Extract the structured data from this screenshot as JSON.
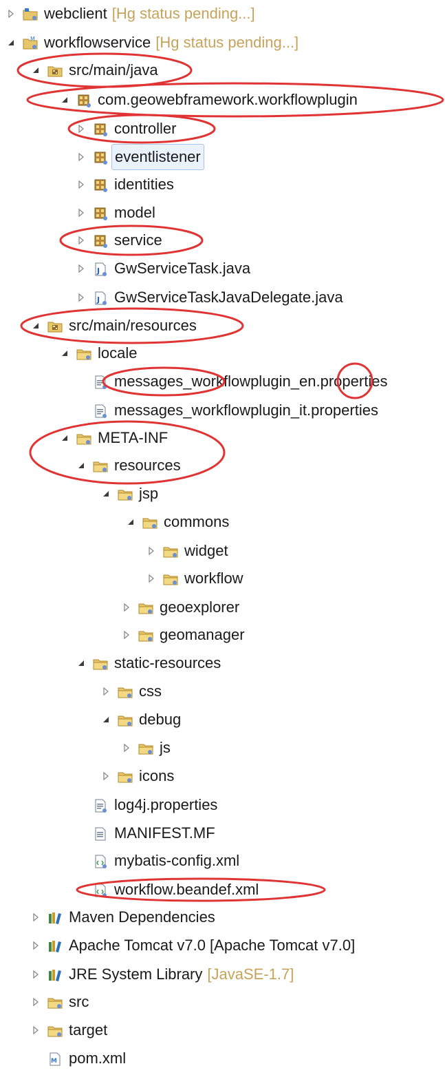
{
  "colors": {
    "annotation": "#e03434",
    "decoration": "#c6a35a",
    "selection_bg": "#eaf2fb"
  },
  "tree": [
    {
      "label": "webclient",
      "decoration": "[Hg status pending...]",
      "icon": "project-icon",
      "expanded": false
    },
    {
      "label": "workflowservice",
      "decoration": "[Hg status pending...]",
      "icon": "maven-project-icon",
      "expanded": true
    },
    {
      "label": "src/main/java",
      "icon": "source-folder-icon",
      "expanded": true
    },
    {
      "label": "com.geowebframework.workflowplugin",
      "icon": "package-icon",
      "expanded": true
    },
    {
      "label": "controller",
      "icon": "package-icon",
      "expanded": false
    },
    {
      "label": "eventlistener",
      "icon": "package-icon",
      "expanded": false,
      "selected": true
    },
    {
      "label": "identities",
      "icon": "package-icon",
      "expanded": false
    },
    {
      "label": "model",
      "icon": "package-icon",
      "expanded": false
    },
    {
      "label": "service",
      "icon": "package-icon",
      "expanded": false
    },
    {
      "label": "GwServiceTask.java",
      "icon": "java-file-icon",
      "expanded": false
    },
    {
      "label": "GwServiceTaskJavaDelegate.java",
      "icon": "java-file-icon",
      "expanded": false
    },
    {
      "label": "src/main/resources",
      "icon": "source-folder-icon",
      "expanded": true
    },
    {
      "label": "locale",
      "icon": "folder-icon",
      "expanded": true
    },
    {
      "label": "messages_workflowplugin_en.properties",
      "icon": "properties-file-icon"
    },
    {
      "label": "messages_workflowplugin_it.properties",
      "icon": "properties-file-icon"
    },
    {
      "label": "META-INF",
      "icon": "folder-icon",
      "expanded": true
    },
    {
      "label": "resources",
      "icon": "folder-icon",
      "expanded": true
    },
    {
      "label": "jsp",
      "icon": "folder-icon",
      "expanded": true
    },
    {
      "label": "commons",
      "icon": "folder-icon",
      "expanded": true
    },
    {
      "label": "widget",
      "icon": "folder-icon",
      "expanded": false
    },
    {
      "label": "workflow",
      "icon": "folder-icon",
      "expanded": false
    },
    {
      "label": "geoexplorer",
      "icon": "folder-icon",
      "expanded": false
    },
    {
      "label": "geomanager",
      "icon": "folder-icon",
      "expanded": false
    },
    {
      "label": "static-resources",
      "icon": "folder-icon",
      "expanded": true
    },
    {
      "label": "css",
      "icon": "folder-icon",
      "expanded": false
    },
    {
      "label": "debug",
      "icon": "folder-icon",
      "expanded": true
    },
    {
      "label": "js",
      "icon": "folder-icon",
      "expanded": false
    },
    {
      "label": "icons",
      "icon": "folder-icon",
      "expanded": false
    },
    {
      "label": "log4j.properties",
      "icon": "properties-file-icon"
    },
    {
      "label": "MANIFEST.MF",
      "icon": "text-file-icon"
    },
    {
      "label": "mybatis-config.xml",
      "icon": "xml-file-icon"
    },
    {
      "label": "workflow.beandef.xml",
      "icon": "xml-file-icon"
    },
    {
      "label": "Maven Dependencies",
      "icon": "library-icon",
      "expanded": false
    },
    {
      "label": "Apache Tomcat v7.0 [Apache Tomcat v7.0]",
      "icon": "library-icon",
      "expanded": false
    },
    {
      "label": "JRE System Library",
      "decoration": "[JavaSE-1.7]",
      "icon": "library-icon",
      "expanded": false
    },
    {
      "label": "src",
      "icon": "folder-icon",
      "expanded": false
    },
    {
      "label": "target",
      "icon": "folder-icon",
      "expanded": false
    },
    {
      "label": "pom.xml",
      "icon": "maven-pom-icon"
    }
  ]
}
